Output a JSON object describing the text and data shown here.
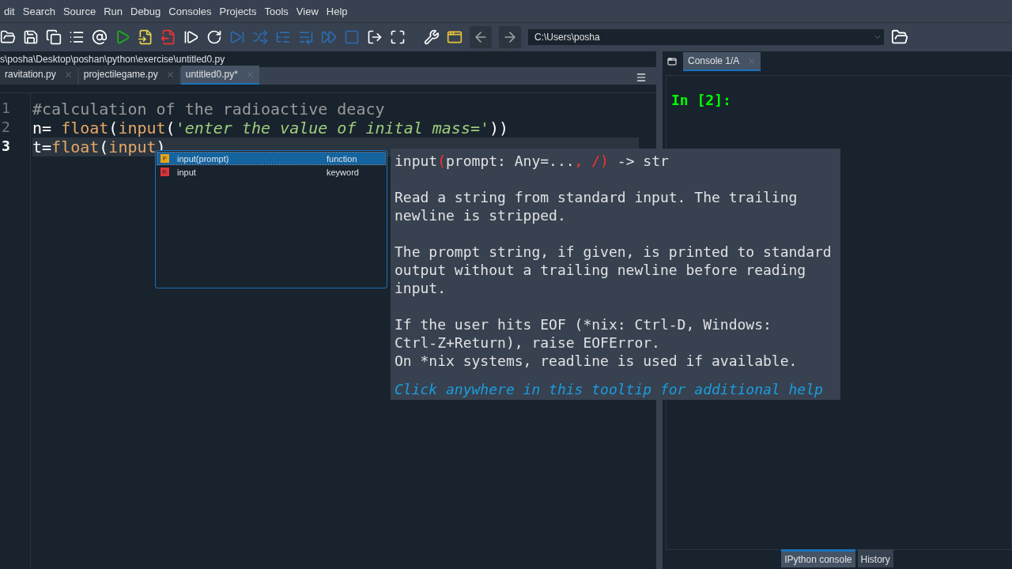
{
  "menu": [
    "dit",
    "Search",
    "Source",
    "Run",
    "Debug",
    "Consoles",
    "Projects",
    "Tools",
    "View",
    "Help"
  ],
  "toolbar": {
    "path": "C:\\Users\\posha"
  },
  "editor": {
    "file_path": "s\\posha\\Desktop\\poshan\\python\\exercise\\untitled0.py",
    "tabs": [
      {
        "label": "ravitation.py",
        "selected": false
      },
      {
        "label": "projectilegame.py",
        "selected": false
      },
      {
        "label": "untitled0.py*",
        "selected": true
      }
    ],
    "lines": [
      {
        "number": "1",
        "current": false,
        "tokens": [
          {
            "kind": "comment",
            "text": "#calculation of the radioactive deacy"
          }
        ]
      },
      {
        "number": "2",
        "current": false,
        "tokens": [
          {
            "kind": "plain",
            "text": "n= "
          },
          {
            "kind": "builtin",
            "text": "float"
          },
          {
            "kind": "plain",
            "text": "("
          },
          {
            "kind": "builtin",
            "text": "input"
          },
          {
            "kind": "plain",
            "text": "("
          },
          {
            "kind": "string",
            "text": "'enter the value of inital mass='"
          },
          {
            "kind": "plain",
            "text": "))"
          }
        ]
      },
      {
        "number": "3",
        "current": true,
        "tokens": [
          {
            "kind": "plain",
            "text": "t="
          },
          {
            "kind": "builtin",
            "text": "float"
          },
          {
            "kind": "plain",
            "text": "("
          },
          {
            "kind": "builtin",
            "text": "input"
          },
          {
            "kind": "plain",
            "text": ")"
          }
        ]
      }
    ],
    "completions": [
      {
        "badge": "F",
        "label": "input(prompt)",
        "type": "function",
        "color": "#e8a317",
        "selected": true
      },
      {
        "badge": "K",
        "label": "input",
        "type": "keyword",
        "color": "#d9343a",
        "selected": false
      }
    ],
    "tooltip": {
      "signature": [
        {
          "kind": "name",
          "text": "input"
        },
        {
          "kind": "paren",
          "text": "("
        },
        {
          "kind": "plain",
          "text": "prompt: Any=..."
        },
        {
          "kind": "paren",
          "text": ", /)"
        },
        {
          "kind": "plain",
          "text": " -> str"
        }
      ],
      "paragraphs": [
        "Read a string from standard input. The trailing\nnewline is stripped.",
        "The prompt string, if given, is printed to standard\noutput without a trailing newline before reading\ninput.",
        "If the user hits EOF (*nix: Ctrl-D, Windows:\nCtrl-Z+Return), raise EOFError.\nOn *nix systems, readline is used if available."
      ],
      "link": "Click anywhere in this tooltip for additional help"
    }
  },
  "console": {
    "tabs": [
      {
        "label": "Console 1/A",
        "selected": true
      }
    ],
    "prompt": "In [2]:"
  },
  "bottom_tabs": [
    {
      "label": "IPython console",
      "selected": true
    },
    {
      "label": "History",
      "selected": false
    }
  ]
}
